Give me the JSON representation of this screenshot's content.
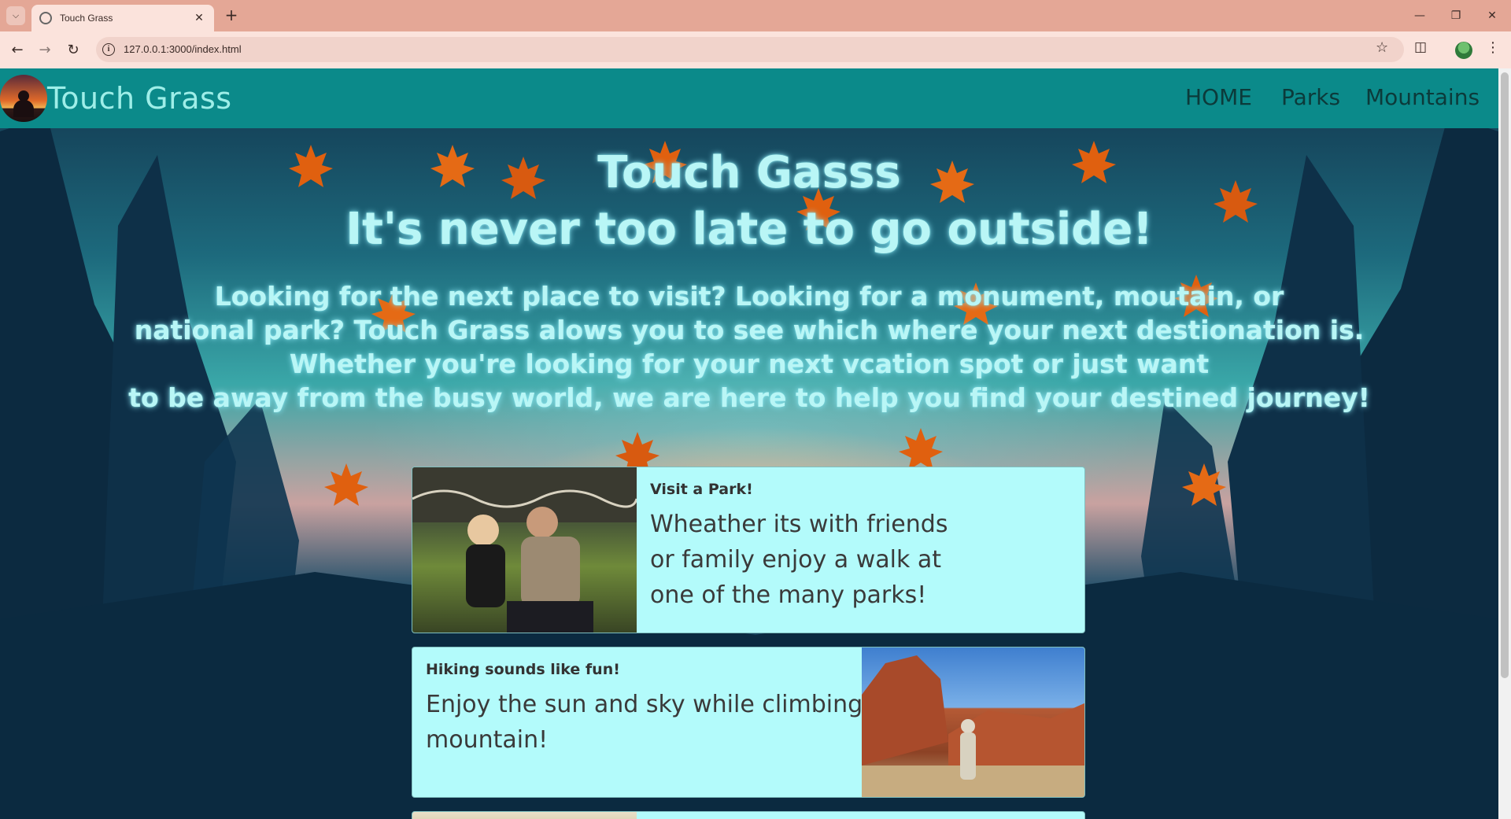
{
  "browser": {
    "tab_title": "Touch Grass",
    "url": "127.0.0.1:3000/index.html",
    "new_tab": "+",
    "tab_close": "✕"
  },
  "navbar": {
    "brand": "Touch Grass",
    "links": [
      "HOME",
      "Parks",
      "Mountains"
    ]
  },
  "hero": {
    "title_line1": "Touch Gasss",
    "title_line2": "It's never too late to go outside!",
    "description_lines": [
      "Looking for the next place to visit? Looking for a monument, moutain, or",
      "national park? Touch Grass alows you to see which where your next destionation is.",
      "Whether you're looking for your next vcation spot or just want",
      "to be away from the busy world, we are here to help you find your destined journey!"
    ]
  },
  "cards": [
    {
      "title": "Visit a Park!",
      "text_lines": [
        "Wheather its with friends",
        "or family enjoy a walk at",
        "one of the many parks!"
      ]
    },
    {
      "title": "Hiking sounds like fun!",
      "text_lines": [
        "Enjoy the sun and sky while climbing a",
        "mountain!"
      ]
    }
  ],
  "colors": {
    "navbar": "#0b8a8a",
    "brand_text": "#9eeee8",
    "card_bg": "#b3fbfb",
    "hero_text": "#b9f6f6",
    "leaf": "#e0600f"
  },
  "icons": [
    "chevron-down-icon",
    "globe-icon",
    "close-icon",
    "plus-icon",
    "minimize-icon",
    "restore-icon",
    "back-icon",
    "forward-icon",
    "reload-icon",
    "info-icon",
    "star-icon",
    "extensions-icon",
    "profile-icon",
    "menu-icon"
  ]
}
